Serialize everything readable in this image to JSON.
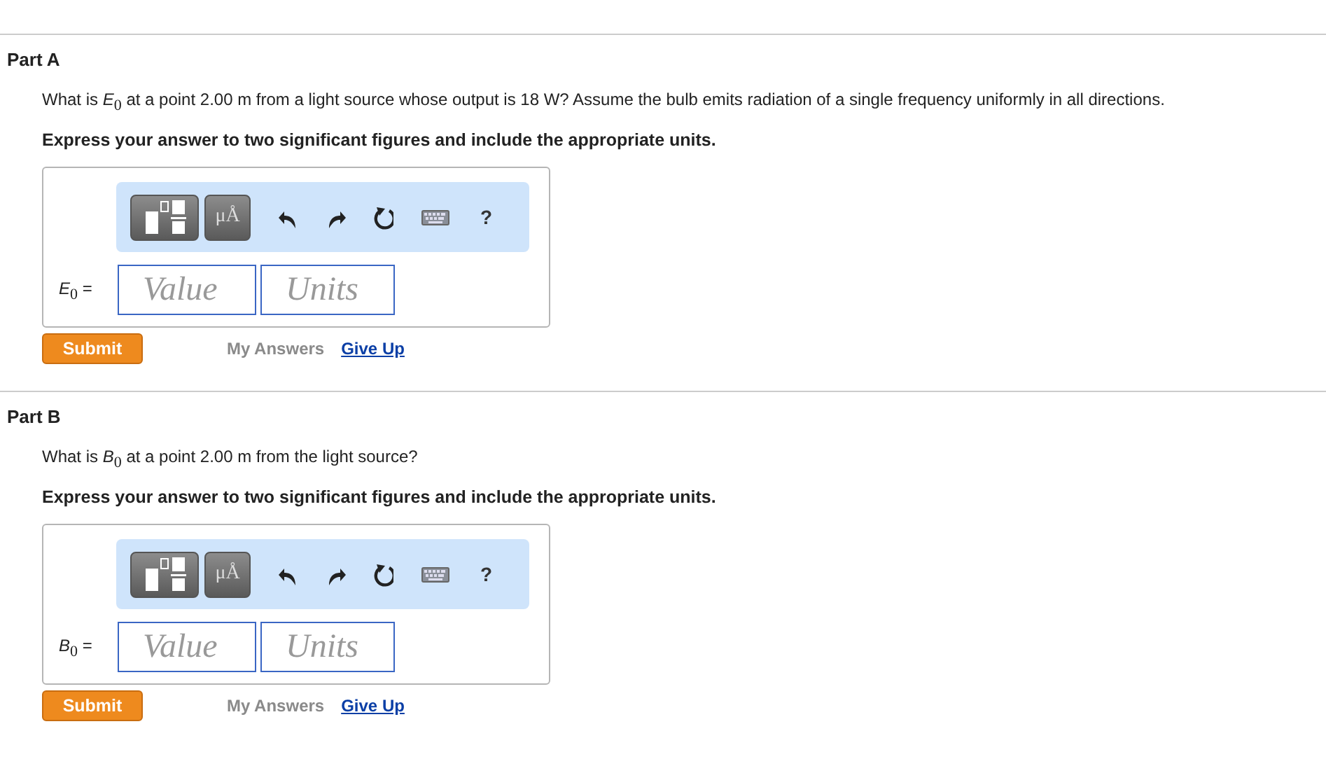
{
  "parts": [
    {
      "title": "Part A",
      "question": "What is *E*$_{0}$ at a point 2.00  m from a light source whose output is 18 W? Assume the bulb emits radiation of a single frequency uniformly in all directions.",
      "instruction": "Express your answer to two significant figures and include the appropriate units.",
      "answer": {
        "label": "*E*$_{0}$ =",
        "value_placeholder": "Value",
        "units_placeholder": "Units",
        "units_button": "μÅ",
        "help": "?"
      },
      "submit": "Submit",
      "my_answers": {
        "label": "My Answers",
        "disabled": true
      },
      "give_up": {
        "label": "Give Up",
        "disabled": false
      }
    },
    {
      "title": "Part B",
      "question": "What is *B*$_{0}$ at a point 2.00  m from the light source?",
      "instruction": "Express your answer to two significant figures and include the appropriate units.",
      "answer": {
        "label": "*B*$_{0}$ =",
        "value_placeholder": "Value",
        "units_placeholder": "Units",
        "units_button": "μÅ",
        "help": "?"
      },
      "submit": "Submit",
      "my_answers": {
        "label": "My Answers",
        "disabled": true
      },
      "give_up": {
        "label": "Give Up",
        "disabled": false
      }
    }
  ]
}
